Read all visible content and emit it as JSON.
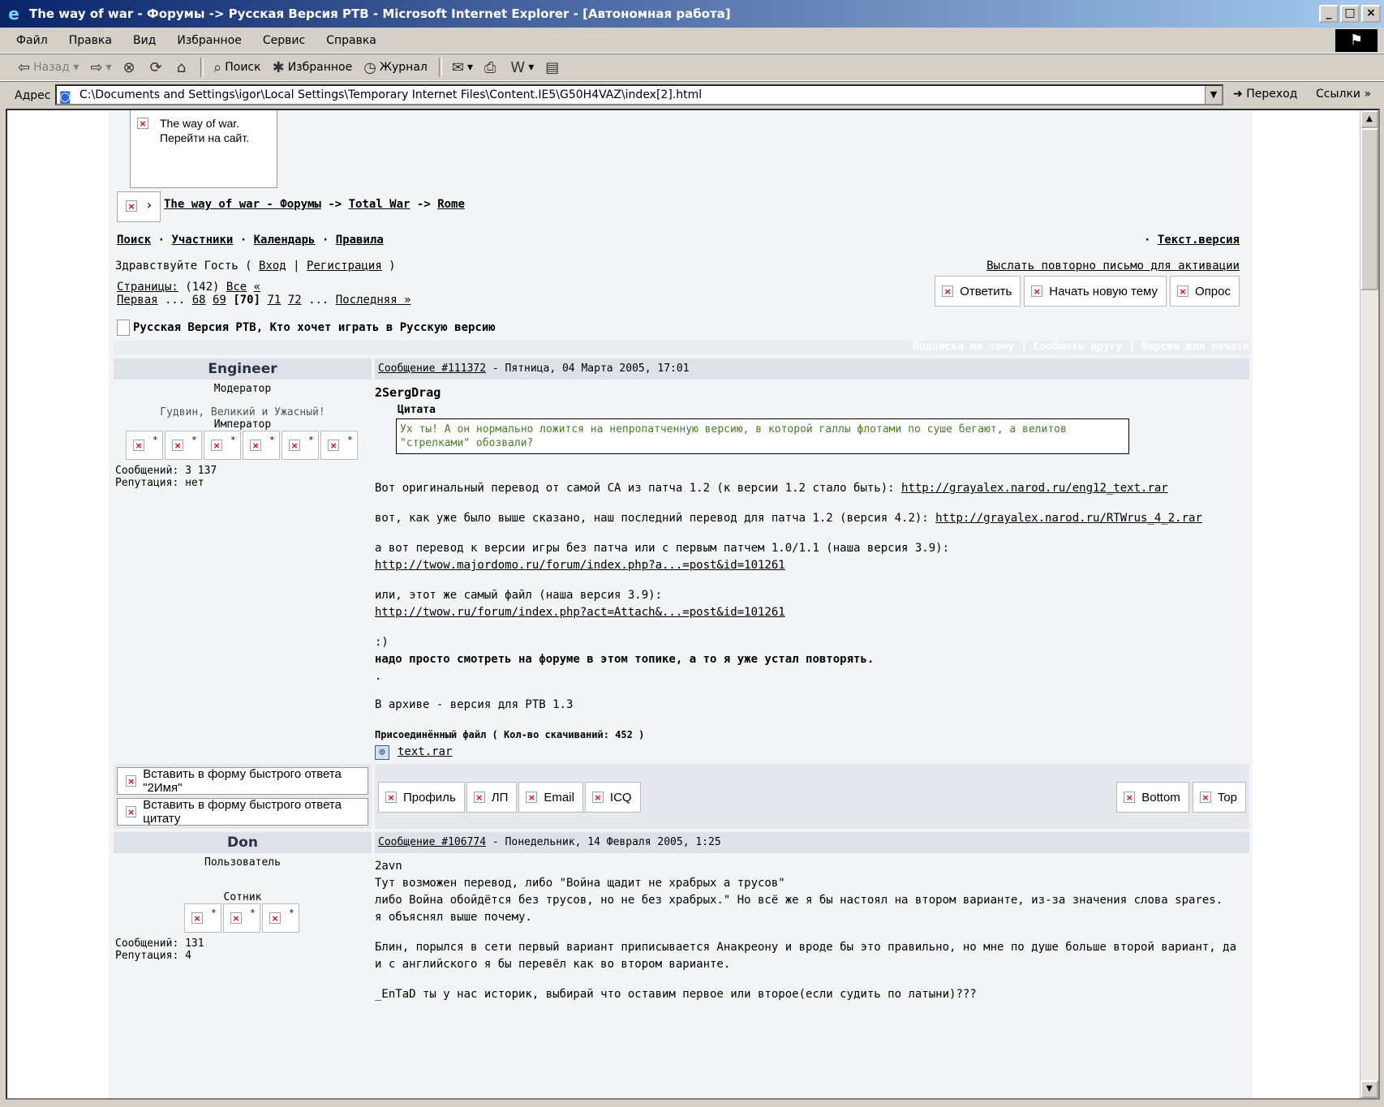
{
  "window": {
    "title": "The way of war - Форумы -> Русская Версия РТВ - Microsoft Internet Explorer - [Автономная работа]"
  },
  "menu": [
    "Файл",
    "Правка",
    "Вид",
    "Избранное",
    "Сервис",
    "Справка"
  ],
  "toolbar": {
    "back": "Назад",
    "search": "Поиск",
    "favorites": "Избранное",
    "history": "Журнал"
  },
  "address": {
    "label": "Адрес",
    "url": "C:\\Documents and Settings\\igor\\Local Settings\\Temporary Internet Files\\Content.IE5\\G50H4VAZ\\index[2].html",
    "go": "Переход",
    "links": "Ссылки"
  },
  "page": {
    "logo_text_1": "The way of war.",
    "logo_text_2": "Перейти на сайт.",
    "breadcrumb": [
      "The way of war - Форумы",
      "Total War",
      "Rome"
    ],
    "breadcrumb_sep": "->",
    "nav": [
      "Поиск",
      "Участники",
      "Календарь",
      "Правила"
    ],
    "text_version": "Текст.версия",
    "greeting": "Здравствуйте Гость (",
    "login": "Вход",
    "register": "Регистрация",
    "resend": "Выслать повторно письмо для активации",
    "pages_label": "Страницы:",
    "pages_count": "(142)",
    "pages_all": "Все",
    "pages_prev": "«",
    "pages_first": "Первая",
    "pages_list": [
      "68",
      "69",
      "[70]",
      "71",
      "72"
    ],
    "pages_last": "Последняя »",
    "btn_reply": "Ответить",
    "btn_new_topic": "Начать новую тему",
    "btn_poll": "Опрос",
    "topic_title": "Русская Версия РТВ, Кто хочет играть в Русскую версию",
    "topic_links": "Подписка на тему | Сообщить другу | Версия для печати"
  },
  "posts": [
    {
      "author": "Engineer",
      "role": "Модератор",
      "motto": "Гудвин, Великий и Ужасный!",
      "rank": "Император",
      "messages": "Сообщений: 3 137",
      "reputation": "Репутация: нет",
      "meta_link": "Сообщение #111372",
      "meta_date": " - Пятница, 04 Марта 2005, 17:01",
      "addressee": "2SergDrag",
      "quote_title": "Цитата",
      "quote": "Ух ты! А он нормально ложится на непропатченную версию, в которой галлы флотами по суше бегают, а велитов \"стрелками\" обозвали?",
      "p1": "Вот оригинальный перевод от самой СА из патча 1.2 (к версии 1.2 стало быть): ",
      "p1_link": "http://grayalex.narod.ru/eng12_text.rar",
      "p2": "вот, как уже было выше сказано, наш последний перевод для патча 1.2 (версия 4.2): ",
      "p2_link": "http://grayalex.narod.ru/RTWrus_4_2.rar",
      "p3": "а вот перевод к версии игры без патча или с первым патчем 1.0/1.1 (наша версия 3.9):",
      "p3_link": "http://twow.majordomo.ru/forum/index.php?a...=post&id=101261",
      "p4": "или, этот же самый файл (наша версия 3.9):",
      "p4_link": "http://twow.ru/forum/index.php?act=Attach&...=post&id=101261",
      "smile": ":)",
      "bold": "надо просто смотреть на форуме в этом топике, а то я уже устал повторять.",
      "dot": ".",
      "archive": "В архиве - версия для РТВ 1.3",
      "attach_title": "Присоединённый файл ( Кол-во скачиваний: 452 )",
      "attach_file": "text.rar"
    },
    {
      "author": "Don",
      "role": "Пользователь",
      "rank": "Сотник",
      "messages": "Сообщений: 131",
      "reputation": "Репутация: 4",
      "meta_link": "Сообщение #106774",
      "meta_date": " - Понедельник, 14 Февраля 2005, 1:25",
      "l1": "2avn",
      "l2": "Тут возможен перевод, либо \"Война щадит не храбрых а трусов\"",
      "l3": "либо Война обойдётся без трусов, но не без храбрых.\" Но всё же я бы настоял на втором варианте, из-за значения слова spares.",
      "l4": "я объяснял выше почему.",
      "l5": "Блин, порылся в сети первый вариант приписывается Анакреону и вроде бы это правильно, но мне по душе больше второй вариант, да и с английского я бы перевёл как во втором варианте.",
      "l6": "_EnTaD ты у нас историк, выбирай что оставим первое или второе(если судить по латыни)???"
    }
  ],
  "post_footer": {
    "quick_name": "Вставить в форму быстрого ответа \"2Имя\"",
    "quick_quote": "Вставить в форму быстрого ответа цитату",
    "profile": "Профиль",
    "pm": "ЛП",
    "email": "Email",
    "icq": "ICQ",
    "bottom": "Bottom",
    "top": "Top"
  }
}
